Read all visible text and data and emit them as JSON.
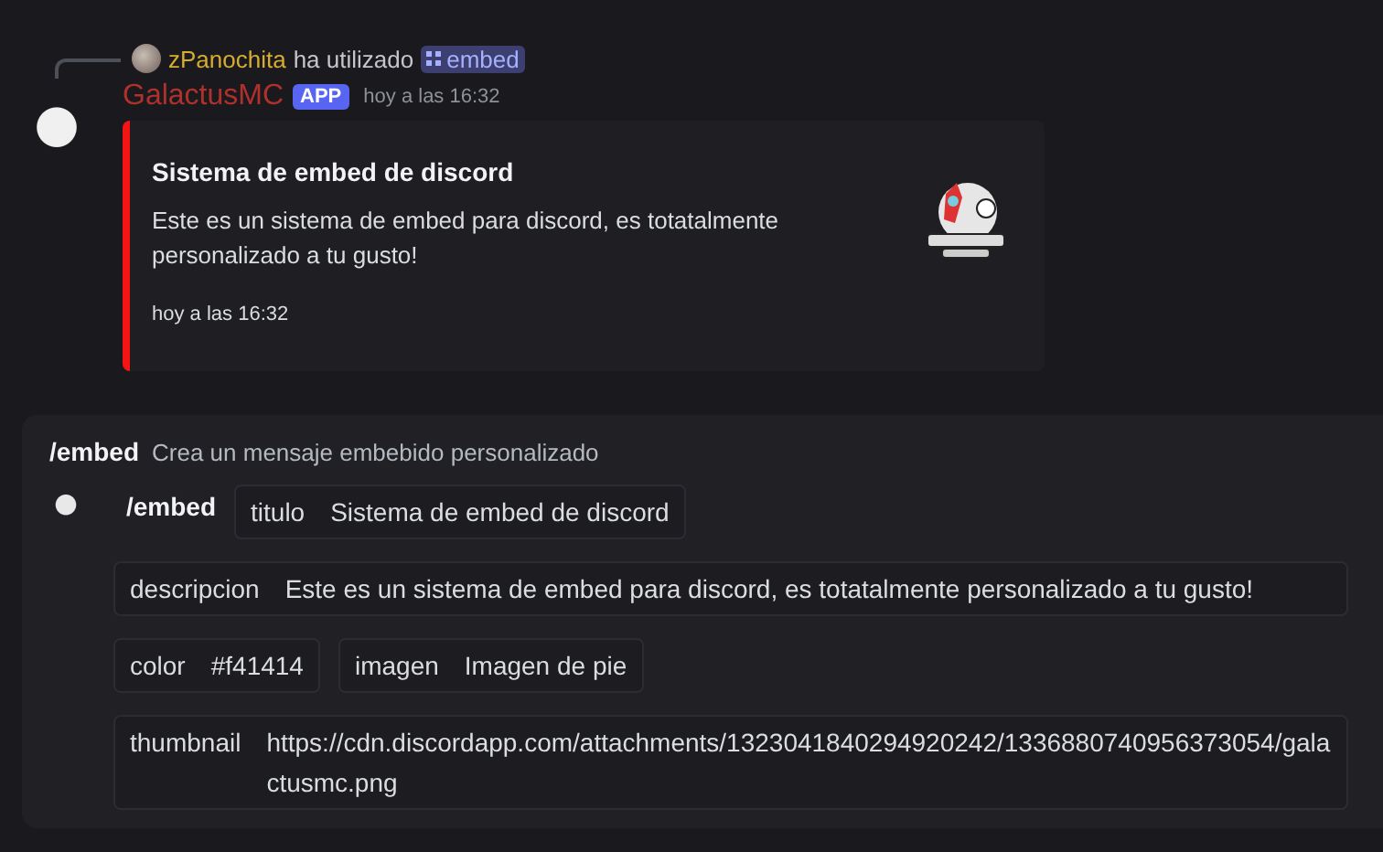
{
  "reply": {
    "user": "zPanochita",
    "action": "ha utilizado",
    "command": "embed"
  },
  "message": {
    "author": "GalactusMC",
    "badge": "APP",
    "time": "hoy a las 16:32",
    "embed": {
      "title": "Sistema de embed de discord",
      "description": "Este es un sistema de embed para discord, es totatalmente personalizado a tu gusto!",
      "footer": "hoy a las 16:32"
    }
  },
  "command_panel": {
    "command": "/embed",
    "description": "Crea un mensaje embebido personalizado",
    "invocation": "/embed",
    "options": [
      {
        "name": "titulo",
        "value": "Sistema de embed de discord",
        "full": false
      },
      {
        "name": "descripcion",
        "value": "Este es un sistema de embed para discord, es totatalmente personalizado a tu gusto!",
        "full": true
      },
      {
        "name": "color",
        "value": "#f41414",
        "full": false
      },
      {
        "name": "imagen",
        "value": "Imagen de pie",
        "full": false
      },
      {
        "name": "thumbnail",
        "value": "https://cdn.discordapp.com/attachments/1323041840294920242/1336880740956373054/galactusmc.png",
        "full": true
      }
    ]
  }
}
